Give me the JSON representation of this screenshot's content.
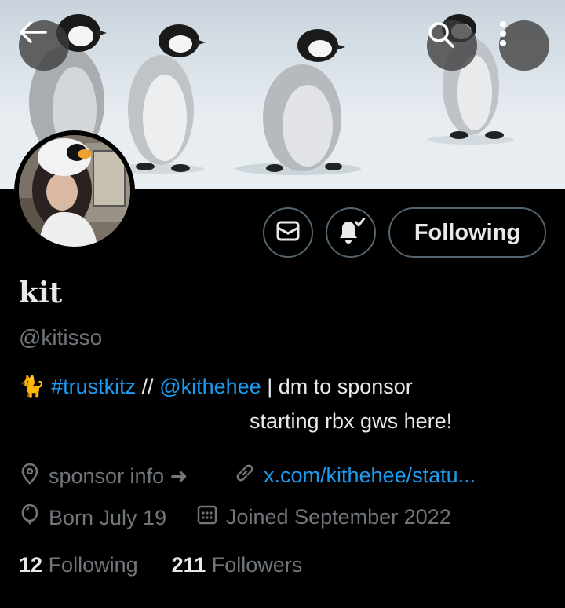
{
  "header": {
    "back_icon": "arrow-left-icon",
    "search_icon": "search-icon",
    "more_icon": "more-vertical-icon"
  },
  "actions": {
    "message_icon": "envelope-icon",
    "notify_icon": "bell-check-icon",
    "following_label": "Following"
  },
  "profile": {
    "name": "kit",
    "handle": "@kitisso",
    "bio": {
      "emoji": "🐈",
      "hashtag": "#trustkitz",
      "separator": " // ",
      "mention": "@kithehee",
      "divider": " | ",
      "text": "dm to sponsor",
      "line2": "starting rbx gws here!"
    },
    "location": "sponsor info ➜",
    "website": "x.com/kithehee/statu...",
    "birthday": "Born July 19",
    "joined": "Joined September 2022"
  },
  "stats": {
    "following_count": "12",
    "following_label": "Following",
    "followers_count": "211",
    "followers_label": "Followers"
  },
  "colors": {
    "accent": "#1d9bf0",
    "secondary_text": "#71767b",
    "primary_text": "#e7e9ea",
    "border": "#536471"
  }
}
